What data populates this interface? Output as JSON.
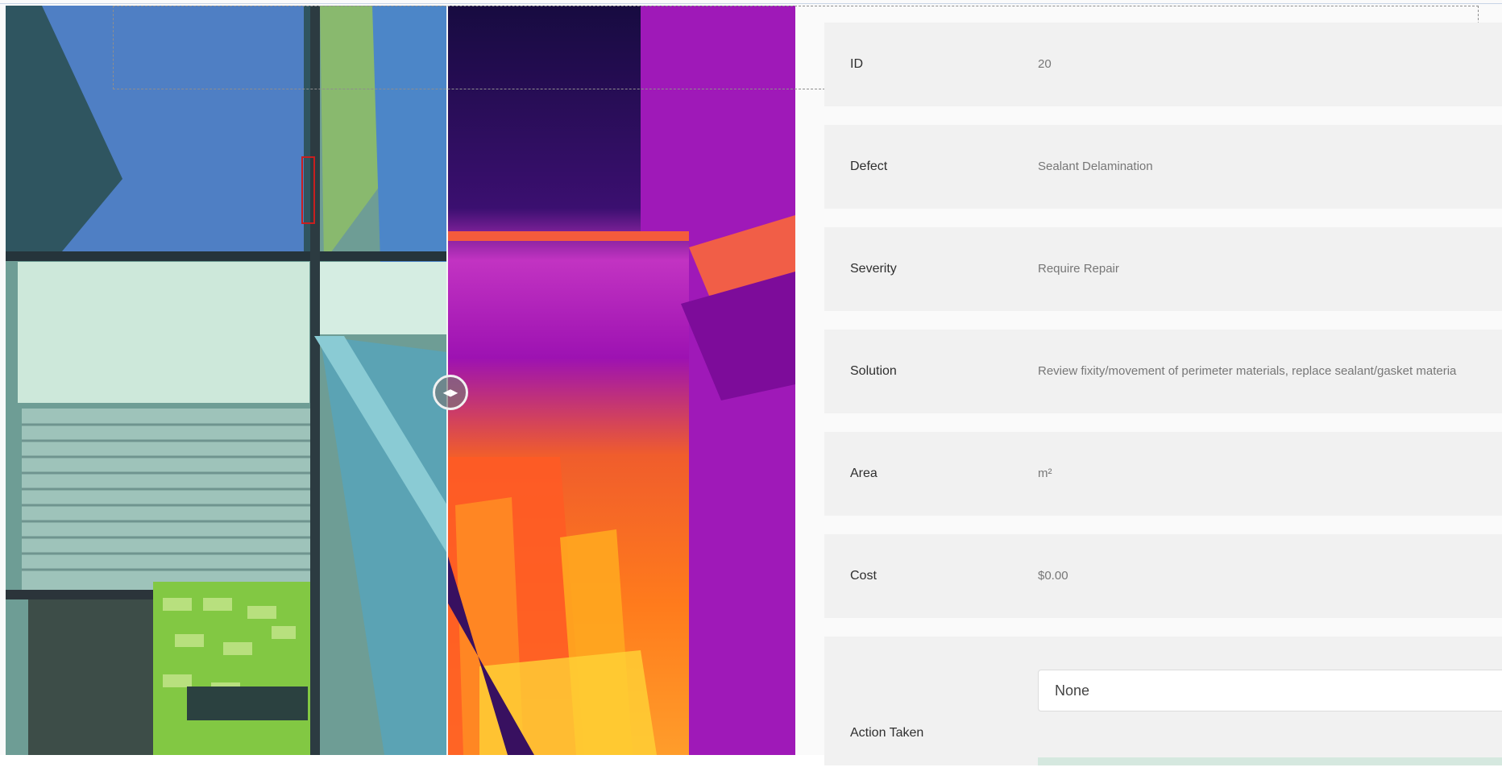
{
  "details": {
    "id_label": "ID",
    "id_value": "20",
    "defect_label": "Defect",
    "defect_value": "Sealant Delamination",
    "severity_label": "Severity",
    "severity_value": "Require Repair",
    "solution_label": "Solution",
    "solution_value": "Review fixity/movement of perimeter materials, replace sealant/gasket materia",
    "area_label": "Area",
    "area_value": "m²",
    "cost_label": "Cost",
    "cost_value": "$0.00",
    "action_label": "Action Taken",
    "action_value": "None"
  },
  "comparison": {
    "handle_icon": "left-right-arrows-icon"
  },
  "colors": {
    "panel_row": "#f1f1f1",
    "thermal_dark": "#220e52",
    "thermal_magenta": "#a113b9",
    "thermal_orange": "#ff6a1f",
    "selection": "#8e8e8e"
  }
}
